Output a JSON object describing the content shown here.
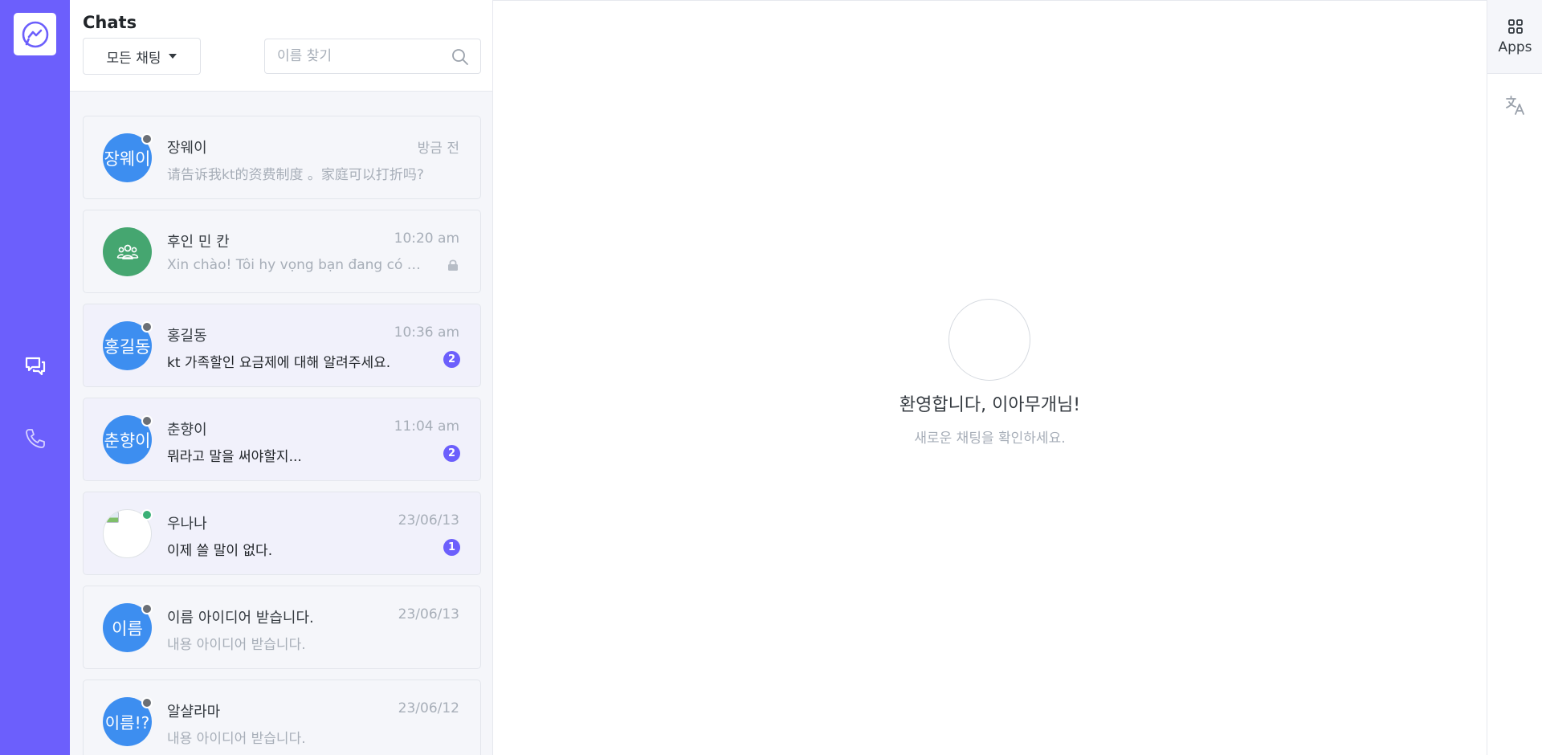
{
  "rail": {
    "logo_icon": "messenger-icon",
    "chat_icon": "chat-bubbles-icon",
    "call_icon": "phone-icon",
    "color": "#6c5ffc"
  },
  "list": {
    "title": "Chats",
    "filter_label": "모든 채팅",
    "search_placeholder": "이름 찾기",
    "items": [
      {
        "name": "장웨이",
        "avatar_text": "장웨이",
        "time": "방금 전",
        "preview": "请告诉我kt的资费制度 。家庭可以打折吗?",
        "badge": "",
        "status": "offline"
      },
      {
        "name": "후인 민 칸",
        "avatar_text": "",
        "avatar_icon": "group-icon",
        "time": "10:20 am",
        "preview": "Xin chào! Tôi hy vọng bạn đang có một ngày tốt lành",
        "badge": "",
        "status": "",
        "locked": true
      },
      {
        "name": "홍길동",
        "avatar_text": "홍길동",
        "time": "10:36 am",
        "preview": "kt 가족할인 요금제에 대해 알려주세요.",
        "badge": "2",
        "status": "offline"
      },
      {
        "name": "춘향이",
        "avatar_text": "춘향이",
        "time": "11:04 am",
        "preview": "뭐라고 말을 써야할지...",
        "badge": "2",
        "status": "offline"
      },
      {
        "name": "우나나",
        "avatar_text": "",
        "time": "23/06/13",
        "preview": "이제 쓸 말이 없다.",
        "badge": "1",
        "status": "online"
      },
      {
        "name": "이름 아이디어 받습니다.",
        "avatar_text": "이름",
        "time": "23/06/13",
        "preview": "내용 아이디어 받습니다.",
        "badge": "",
        "status": "offline"
      },
      {
        "name": "알샬라마",
        "avatar_text": "이름!?",
        "time": "23/06/12",
        "preview": "내용 아이디어 받습니다.",
        "badge": "",
        "status": "offline"
      }
    ]
  },
  "main": {
    "welcome_title": "환영합니다, 이아무개님!",
    "welcome_subtitle": "새로운 채팅을 확인하세요."
  },
  "right_sidebar": {
    "apps_label": "Apps",
    "apps_icon": "grid-icon",
    "translate_icon": "translate-icon"
  },
  "colors": {
    "accent": "#6c5ffc",
    "avatar_blue": "#3d8ef0",
    "avatar_green": "#45a670",
    "status_offline": "#6b6f75",
    "status_online": "#3bb077"
  }
}
